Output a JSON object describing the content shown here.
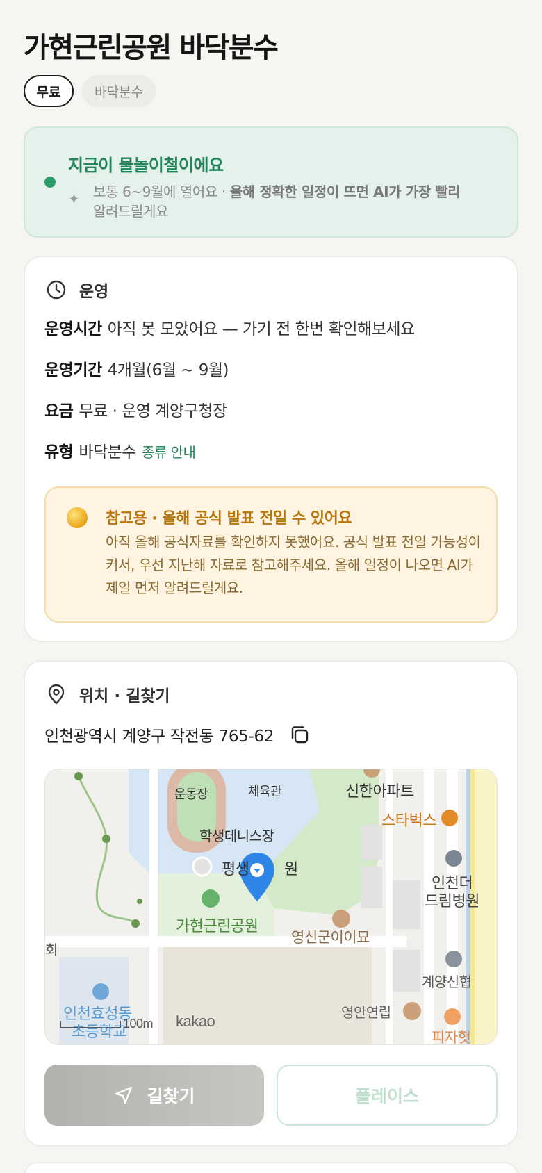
{
  "title": "가현근린공원 바닥분수",
  "chips": {
    "price": "무료",
    "type": "바닥분수"
  },
  "season": {
    "headline": "지금이 물놀이철이에요",
    "sparkle_icon": "sparkle-icon",
    "note_plain": "보통 6~9월에 열어요 · ",
    "note_bold": "올해 정확한 일정이 뜨면 AI가 가장 빨리",
    "note_tail": "알려드릴게요",
    "accent": "#23855a"
  },
  "operation": {
    "section_title": "운영",
    "rows": [
      {
        "key": "운영시간",
        "value": "아직 못 모았어요 — 가기 전 한번 확인해보세요"
      },
      {
        "key": "운영기간",
        "value": "4개월(6월 ~ 9월)"
      },
      {
        "key": "요금",
        "value": "무료 · 운영 계양구청장"
      },
      {
        "key": "유형",
        "value": "바닥분수",
        "link": "종류 안내"
      }
    ],
    "notice": {
      "title": "참고용 · 올해 공식 발표 전일 수 있어요",
      "body": "아직 올해 공식자료를 확인하지 못했어요. 공식 발표 전일 가능성이 커서, 우선 지난해 자료로 참고해주세요. 올해 일정이 나오면 AI가 제일 먼저 알려드릴게요.",
      "color": "#b8760c"
    }
  },
  "location": {
    "section_title": "위치 · 길찾기",
    "address": "인천광역시 계양구 작전동 765-62",
    "map": {
      "labels": {
        "stadium": "운동장",
        "gym": "체육관",
        "apartment": "신한아파트",
        "starbucks": "스타벅스",
        "tennis": "학생테니스장",
        "pyeongsaeng": "평생",
        "pyeongsaeng_tail": "원",
        "hospital_1": "인천더",
        "hospital_2": "드림병원",
        "park": "가현근린공원",
        "shrine": "영신군이이묘",
        "left_edge": "회",
        "bank": "계양신협",
        "school_1": "인천효성동",
        "school_2": "초등학교",
        "yeongan": "영안연립",
        "pizza": "피자헛",
        "scale": "100m",
        "brand": "kakao"
      }
    },
    "buttons": {
      "route": "길찾기",
      "place": "플레이스"
    }
  }
}
